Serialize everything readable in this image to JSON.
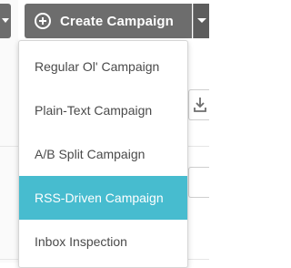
{
  "toolbar": {
    "create_campaign_label": "Create Campaign"
  },
  "campaign_menu": {
    "items": [
      {
        "label": "Regular Ol' Campaign"
      },
      {
        "label": "Plain-Text Campaign"
      },
      {
        "label": "A/B Split Campaign"
      },
      {
        "label": "RSS-Driven Campaign",
        "highlighted": true
      },
      {
        "label": "Inbox Inspection"
      }
    ]
  },
  "colors": {
    "button_bg": "#6d6d6d",
    "highlight": "#47bccf",
    "menu_text": "#4a4a4a"
  }
}
